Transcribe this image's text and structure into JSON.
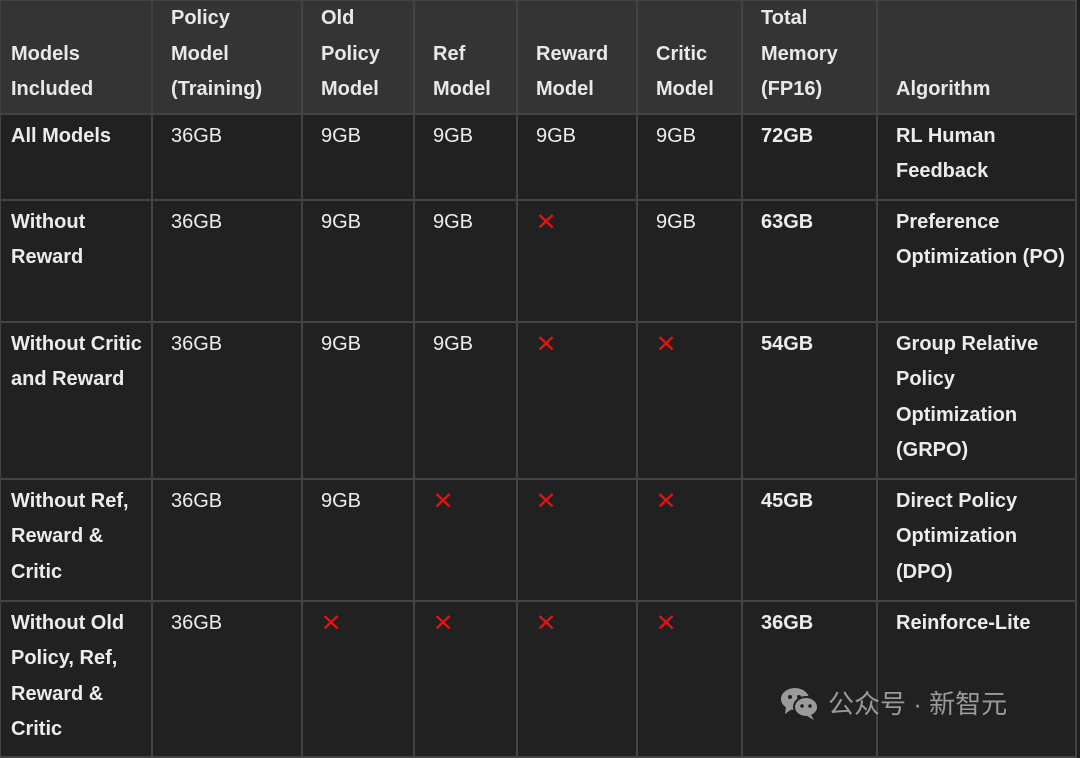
{
  "headers": [
    "Models Included",
    "Policy Model (Training)",
    "Old Policy Model",
    "Ref Model",
    "Reward Model",
    "Critic Model",
    "Total Memory (FP16)",
    "Algorithm"
  ],
  "header_lines": [
    [
      "Models",
      "Included"
    ],
    [
      "Policy",
      "Model",
      "(Training)"
    ],
    [
      "Old",
      "Policy",
      "Model"
    ],
    [
      "Ref",
      "Model"
    ],
    [
      "Reward",
      "Model"
    ],
    [
      "Critic",
      "Model"
    ],
    [
      "Total",
      "Memory",
      "(FP16)"
    ],
    [
      "Algorithm"
    ]
  ],
  "rows": [
    {
      "name": "All Models",
      "policy": "36GB",
      "old_policy": "9GB",
      "ref": "9GB",
      "reward": "9GB",
      "critic": "9GB",
      "total": "72GB",
      "algorithm": "RL Human Feedback"
    },
    {
      "name": "Without Reward",
      "policy": "36GB",
      "old_policy": "9GB",
      "ref": "9GB",
      "reward": "✕",
      "critic": "9GB",
      "total": "63GB",
      "algorithm": "Preference Optimization (PO)"
    },
    {
      "name": "Without Critic and Reward",
      "policy": "36GB",
      "old_policy": "9GB",
      "ref": "9GB",
      "reward": "✕",
      "critic": "✕",
      "total": "54GB",
      "algorithm": "Group Relative Policy Optimization (GRPO)"
    },
    {
      "name": "Without Ref, Reward & Critic",
      "policy": "36GB",
      "old_policy": "9GB",
      "ref": "✕",
      "reward": "✕",
      "critic": "✕",
      "total": "45GB",
      "algorithm": "Direct Policy Optimization (DPO)"
    },
    {
      "name": "Without Old Policy, Ref, Reward & Critic",
      "policy": "36GB",
      "old_policy": "✕",
      "ref": "✕",
      "reward": "✕",
      "critic": "✕",
      "total": "36GB",
      "algorithm": "Reinforce-Lite"
    }
  ],
  "excluded_mark": "✕",
  "colors": {
    "excluded": "#e01313",
    "header_bg": "#353435",
    "cell_bg": "#212121",
    "border": "#434343"
  },
  "watermark": {
    "icon": "wechat-icon",
    "text": "公众号 · 新智元"
  }
}
